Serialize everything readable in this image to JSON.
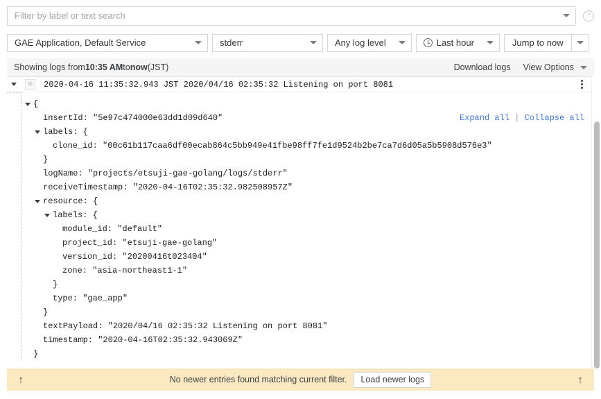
{
  "search": {
    "placeholder": "Filter by label or text search",
    "dropdown_icon": "chevron-down-icon",
    "help_icon": "help-circle-icon"
  },
  "controls": {
    "resource": "GAE Application, Default Service",
    "log_name": "stderr",
    "log_level": "Any log level",
    "time_range": "Last hour",
    "jump": "Jump to now",
    "clock_icon": "clock-icon"
  },
  "status_bar": {
    "prefix": "Showing logs from ",
    "from_time": "10:35 AM",
    "middle": " to ",
    "to_time": "now",
    "suffix": " (JST)",
    "download": "Download logs",
    "view_options": "View Options"
  },
  "entry": {
    "expand_icon": "triangle-down-icon",
    "severity_icon": "asterisk-icon",
    "severity_glyph": "✳",
    "summary": "2020-04-16 11:35:32.943 JST 2020/04/16 02:35:32 Listening on port 8081",
    "menu_icon": "kebab-menu-icon",
    "expand_all": "Expand all",
    "separator": "|",
    "collapse_all": "Collapse all",
    "json_lines": [
      {
        "indent": 0,
        "toggle": true,
        "text": "{"
      },
      {
        "indent": 1,
        "toggle": false,
        "text": "insertId: \"5e97c474000e63dd1d09d640\""
      },
      {
        "indent": 1,
        "toggle": true,
        "text": "labels: {"
      },
      {
        "indent": 2,
        "toggle": false,
        "text": "clone_id: \"00c61b117caa6df00ecab864c5bb949e41fbe98ff7fe1d9524b2be7ca7d6d05a5b5908d576e3\""
      },
      {
        "indent": 1,
        "toggle": false,
        "text": "}"
      },
      {
        "indent": 1,
        "toggle": false,
        "text": "logName: \"projects/etsuji-gae-golang/logs/stderr\""
      },
      {
        "indent": 1,
        "toggle": false,
        "text": "receiveTimestamp: \"2020-04-16T02:35:32.982508957Z\""
      },
      {
        "indent": 1,
        "toggle": true,
        "text": "resource: {"
      },
      {
        "indent": 2,
        "toggle": true,
        "text": "labels: {"
      },
      {
        "indent": 3,
        "toggle": false,
        "text": "module_id: \"default\""
      },
      {
        "indent": 3,
        "toggle": false,
        "text": "project_id: \"etsuji-gae-golang\""
      },
      {
        "indent": 3,
        "toggle": false,
        "text": "version_id: \"20200416t023404\""
      },
      {
        "indent": 3,
        "toggle": false,
        "text": "zone: \"asia-northeast1-1\""
      },
      {
        "indent": 2,
        "toggle": false,
        "text": "}"
      },
      {
        "indent": 2,
        "toggle": false,
        "text": "type: \"gae_app\""
      },
      {
        "indent": 1,
        "toggle": false,
        "text": "}"
      },
      {
        "indent": 1,
        "toggle": false,
        "text": "textPayload: \"2020/04/16 02:35:32 Listening on port 8081\""
      },
      {
        "indent": 1,
        "toggle": false,
        "text": "timestamp: \"2020-04-16T02:35:32.943069Z\""
      },
      {
        "indent": 0,
        "toggle": false,
        "text": "}"
      }
    ]
  },
  "footer": {
    "scroll_up_icon": "arrow-up-icon",
    "message": "No newer entries found matching current filter.",
    "load_button": "Load newer logs",
    "scroll_up_icon_right": "arrow-up-icon",
    "arrow_glyph": "↑",
    "background_color": "#fbe9c1"
  },
  "colors": {
    "link_blue": "#3b78e7",
    "border_gray": "#d6d6d6",
    "bar_gray": "#f5f5f5"
  }
}
